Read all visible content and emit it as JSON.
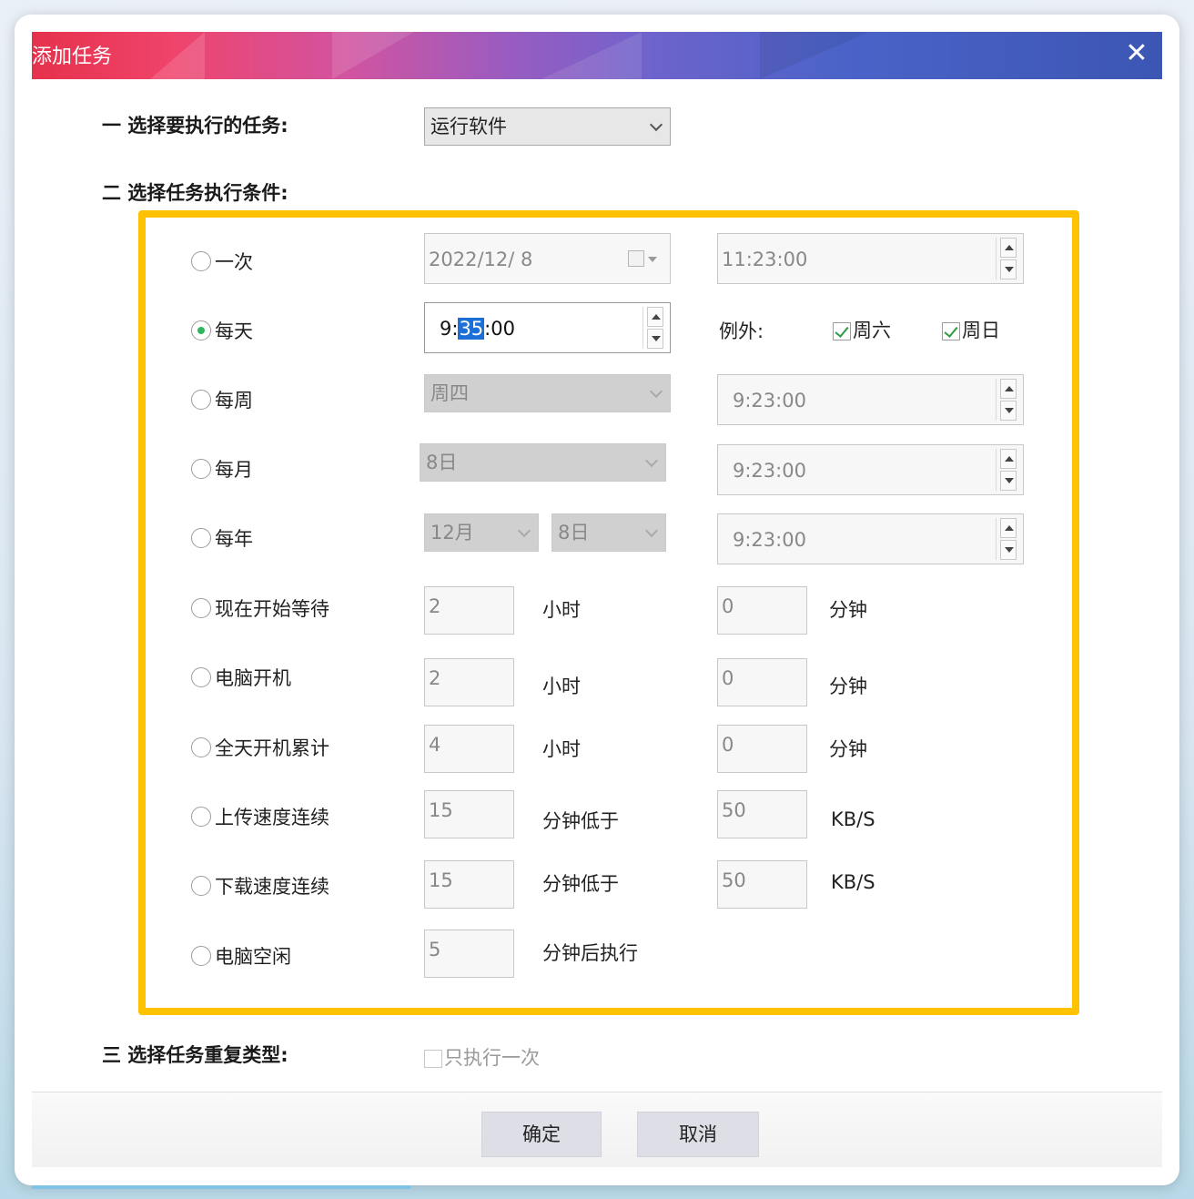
{
  "window": {
    "title": "添加任务",
    "close_glyph": "✕"
  },
  "sections": {
    "task": "一 选择要执行的任务:",
    "condition": "二 选择任务执行条件:",
    "repeat": "三 选择任务重复类型:"
  },
  "task_select": {
    "value": "运行软件"
  },
  "conditions": {
    "once": {
      "label": "一次",
      "date": "2022/12/  8",
      "time": "11:23:00"
    },
    "daily": {
      "label": "每天",
      "time_prefix": "9:",
      "time_selected": "35",
      "time_suffix": ":00",
      "except_label": "例外:",
      "sat_label": "周六",
      "sun_label": "周日",
      "sat_checked": true,
      "sun_checked": true
    },
    "weekly": {
      "label": "每周",
      "day": "周四",
      "time": "9:23:00"
    },
    "monthly": {
      "label": "每月",
      "day": "8日",
      "time": "9:23:00"
    },
    "yearly": {
      "label": "每年",
      "month": "12月",
      "day": "8日",
      "time": "9:23:00"
    },
    "wait_now": {
      "label": "现在开始等待",
      "hours": "2",
      "hours_unit": "小时",
      "minutes": "0",
      "minutes_unit": "分钟"
    },
    "boot": {
      "label": "电脑开机",
      "hours": "2",
      "hours_unit": "小时",
      "minutes": "0",
      "minutes_unit": "分钟"
    },
    "uptime_total": {
      "label": "全天开机累计",
      "hours": "4",
      "hours_unit": "小时",
      "minutes": "0",
      "minutes_unit": "分钟"
    },
    "upload_speed": {
      "label": "上传速度连续",
      "minutes": "15",
      "minutes_unit": "分钟低于",
      "speed": "50",
      "speed_unit": "KB/S"
    },
    "download_speed": {
      "label": "下载速度连续",
      "minutes": "15",
      "minutes_unit": "分钟低于",
      "speed": "50",
      "speed_unit": "KB/S"
    },
    "idle": {
      "label": "电脑空闲",
      "minutes": "5",
      "minutes_unit": "分钟后执行"
    }
  },
  "selected_condition": "daily",
  "repeat": {
    "only_once_label": "只执行一次",
    "only_once_checked": false
  },
  "buttons": {
    "ok": "确定",
    "cancel": "取消"
  },
  "colors": {
    "highlight_border": "#ffc200",
    "radio_selected": "#2fb55e",
    "check_mark": "#2c9a40",
    "text_selection": "#1b6fd6"
  }
}
